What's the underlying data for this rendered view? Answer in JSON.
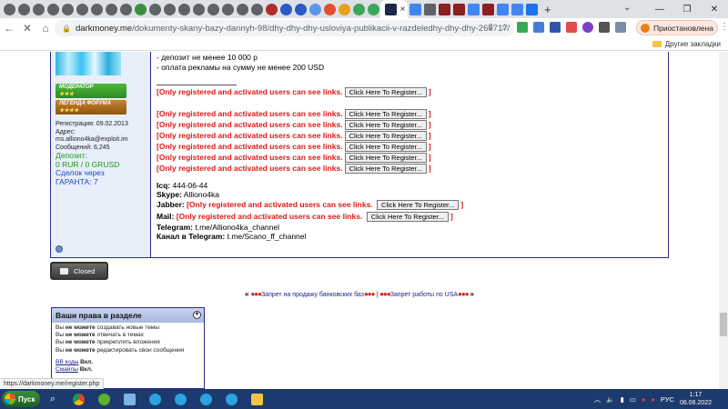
{
  "browser": {
    "tabs_count": 30,
    "active_tab_close": "×",
    "new_tab": "+",
    "window_controls": [
      "⌄",
      "—",
      "❐",
      "✕"
    ],
    "url_host": "darkmoney.me",
    "url_path": "/dokumenty-skany-bazy-dannyh-98/dhy-dhy-dhy-usloviya-publikacii-v-razdeledhy-dhy-dhy-260717/",
    "paused_label": "Приостановлена",
    "other_bookmarks": "Другие закладки"
  },
  "user": {
    "badge_moderator": "МОДЕРАТОР",
    "badge_legend": "ЛЕГЕНДА ФОРУМА",
    "stars_mod": "★★★",
    "stars_leg": "★★★★",
    "registration": "Регистрация: 09.02.2013",
    "address_label": "Адрес:",
    "address": "ms.alliono4ka@exploit.im",
    "messages": "Сообщений: 6,245",
    "deposit_label": "Депозит:",
    "deposit_value": "0 RUR / 0 GRUSD",
    "deals_label": "Сделок через",
    "guarantee": "ГАРАНТА: 7"
  },
  "post": {
    "line_deposit": "- депозит не менее 10 000 р",
    "line_ads": "- оплата рекламы на сумму не менее 200 USD",
    "hidden_text": "[Only registered and activated users can see links.",
    "bracket_close": "]",
    "register_btn": "Click Here To Register...",
    "icq_label": "Icq:",
    "icq_value": "444-06-44",
    "skype_label": "Skype:",
    "skype_value": "Alliono4ka",
    "jabber_label": "Jabber:",
    "mail_label": "Mail:",
    "telegram_label": "Telegram:",
    "telegram_value": "t.me/Alliono4ka_channel",
    "channel_label": "Канал в Telegram:",
    "channel_value": "t.me/Scano_ff_channel"
  },
  "closed_label": "Closed",
  "related": {
    "left_quote": "«",
    "right_quote": "»",
    "dots": "●●●",
    "thread1": "Запрет на продажу банковских баз",
    "separator": "|",
    "thread2": "Запрет работы по USA"
  },
  "rights": {
    "title": "Ваши права в разделе",
    "toggle": "▾",
    "prefix": "Вы",
    "cannot": "не можете",
    "r1": "создавать новые темы",
    "r2": "отвечать в темах",
    "r3": "прикреплять вложения",
    "r4": "редактировать свои сообщения",
    "bb_label": "BB коды",
    "bb_value": "Вкл.",
    "smilies_label": "Смайлы",
    "smilies_value": "Вкл."
  },
  "status_url": "https://darkmoney.me/register.php",
  "taskbar": {
    "start": "Пуск",
    "lang": "РУС",
    "time": "1:17",
    "date": "06.06.2022"
  }
}
